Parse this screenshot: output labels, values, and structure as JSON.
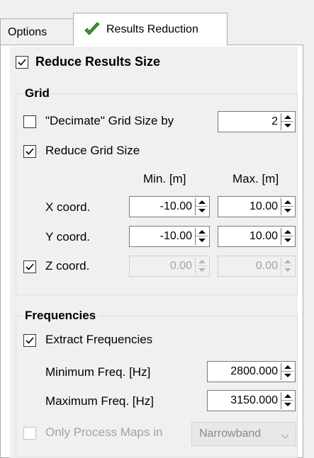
{
  "tabs": [
    {
      "label": "Options"
    },
    {
      "label": "Results Reduction"
    }
  ],
  "reduce_results_size": {
    "label": "Reduce Results Size",
    "checked": true
  },
  "grid": {
    "title": "Grid",
    "decimate": {
      "label": "\"Decimate\" Grid Size by",
      "checked": false,
      "value": "2"
    },
    "reduce_grid": {
      "label": "Reduce Grid Size",
      "checked": true
    },
    "col_min": "Min. [m]",
    "col_max": "Max. [m]",
    "x": {
      "label": "X coord.",
      "min": "-10.00",
      "max": "10.00"
    },
    "y": {
      "label": "Y coord.",
      "min": "-10.00",
      "max": "10.00"
    },
    "z": {
      "label": "Z coord.",
      "checked": true,
      "min": "0.00",
      "max": "0.00",
      "disabled": true
    }
  },
  "frequencies": {
    "title": "Frequencies",
    "extract": {
      "label": "Extract Frequencies",
      "checked": true
    },
    "min_freq": {
      "label": "Minimum Freq. [Hz]",
      "value": "2800.000"
    },
    "max_freq": {
      "label": "Maximum Freq. [Hz]",
      "value": "3150.000"
    },
    "only_process": {
      "label": "Only Process Maps in",
      "checked": false,
      "disabled": true
    },
    "band": {
      "selected": "Narrowband",
      "disabled": true
    }
  },
  "icons": {
    "results_tab_icon": "checkmark-icon"
  },
  "colors": {
    "checkmark_green": "#3c9a2e"
  }
}
